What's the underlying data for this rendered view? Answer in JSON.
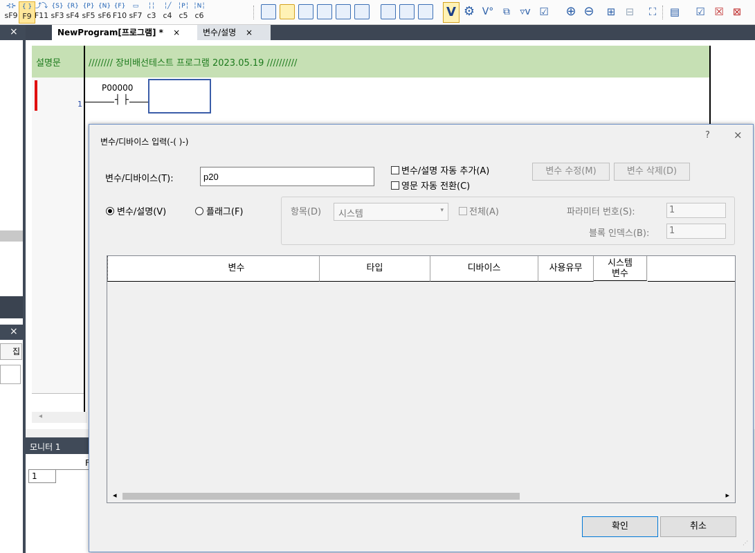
{
  "toolbar": {
    "fkeys": [
      {
        "sym": "⊰⊱",
        "key": "sF9"
      },
      {
        "sym": "{ }",
        "key": "F9"
      },
      {
        "sym": "⤴⤵",
        "key": "F11"
      },
      {
        "sym": "{S}",
        "key": "sF3"
      },
      {
        "sym": "{R}",
        "key": "sF4"
      },
      {
        "sym": "{P}",
        "key": "sF5"
      },
      {
        "sym": "{N}",
        "key": "sF6"
      },
      {
        "sym": "{F}",
        "key": "F10"
      },
      {
        "sym": "▭",
        "key": "sF7"
      },
      {
        "sym": "╎╎",
        "key": "c3"
      },
      {
        "sym": "╎╱",
        "key": "c4"
      },
      {
        "sym": "╎P╎",
        "key": "c5"
      },
      {
        "sym": "╎N╎",
        "key": "c6"
      }
    ]
  },
  "left_panel": {
    "close_top": "×",
    "close_mid": "×",
    "edit_label": "집"
  },
  "tabs": [
    {
      "label": "NewProgram[프로그램] *",
      "close": "×"
    },
    {
      "label": "변수/설명",
      "close": "×"
    }
  ],
  "ladder": {
    "comment_label": "설명문",
    "comment_text": "//////// 장비배선테스트 프로그램 2023.05.19 //////////",
    "contact_label": "P00000",
    "contact_symbol": "┤ ├",
    "row_number": "1"
  },
  "monitor": {
    "title": "모니터 1",
    "col_header": "F",
    "row1": "1"
  },
  "dialog": {
    "title": "변수/디바이스 입력(-( )-)",
    "help": "?",
    "close": "×",
    "device_label": "변수/디바이스(T):",
    "device_value": "p20",
    "auto_add_label": "변수/설명 자동 추가(A)",
    "english_switch_label": "영문 자동 전환(C)",
    "edit_var_button": "변수 수정(M)",
    "delete_var_button": "변수 삭제(D)",
    "radio_var_label": "변수/설명(V)",
    "radio_flag_label": "플래그(F)",
    "item_label": "항목(D)",
    "item_value": "시스템",
    "all_label": "전체(A)",
    "param_label": "파라미터 번호(S):",
    "param_value": "1",
    "block_label": "블록 인덱스(B):",
    "block_value": "1",
    "grid_headers": [
      "",
      "변수",
      "타입",
      "디바이스",
      "사용유무",
      "시스템\n변수"
    ],
    "ok_button": "확인",
    "cancel_button": "취소"
  }
}
